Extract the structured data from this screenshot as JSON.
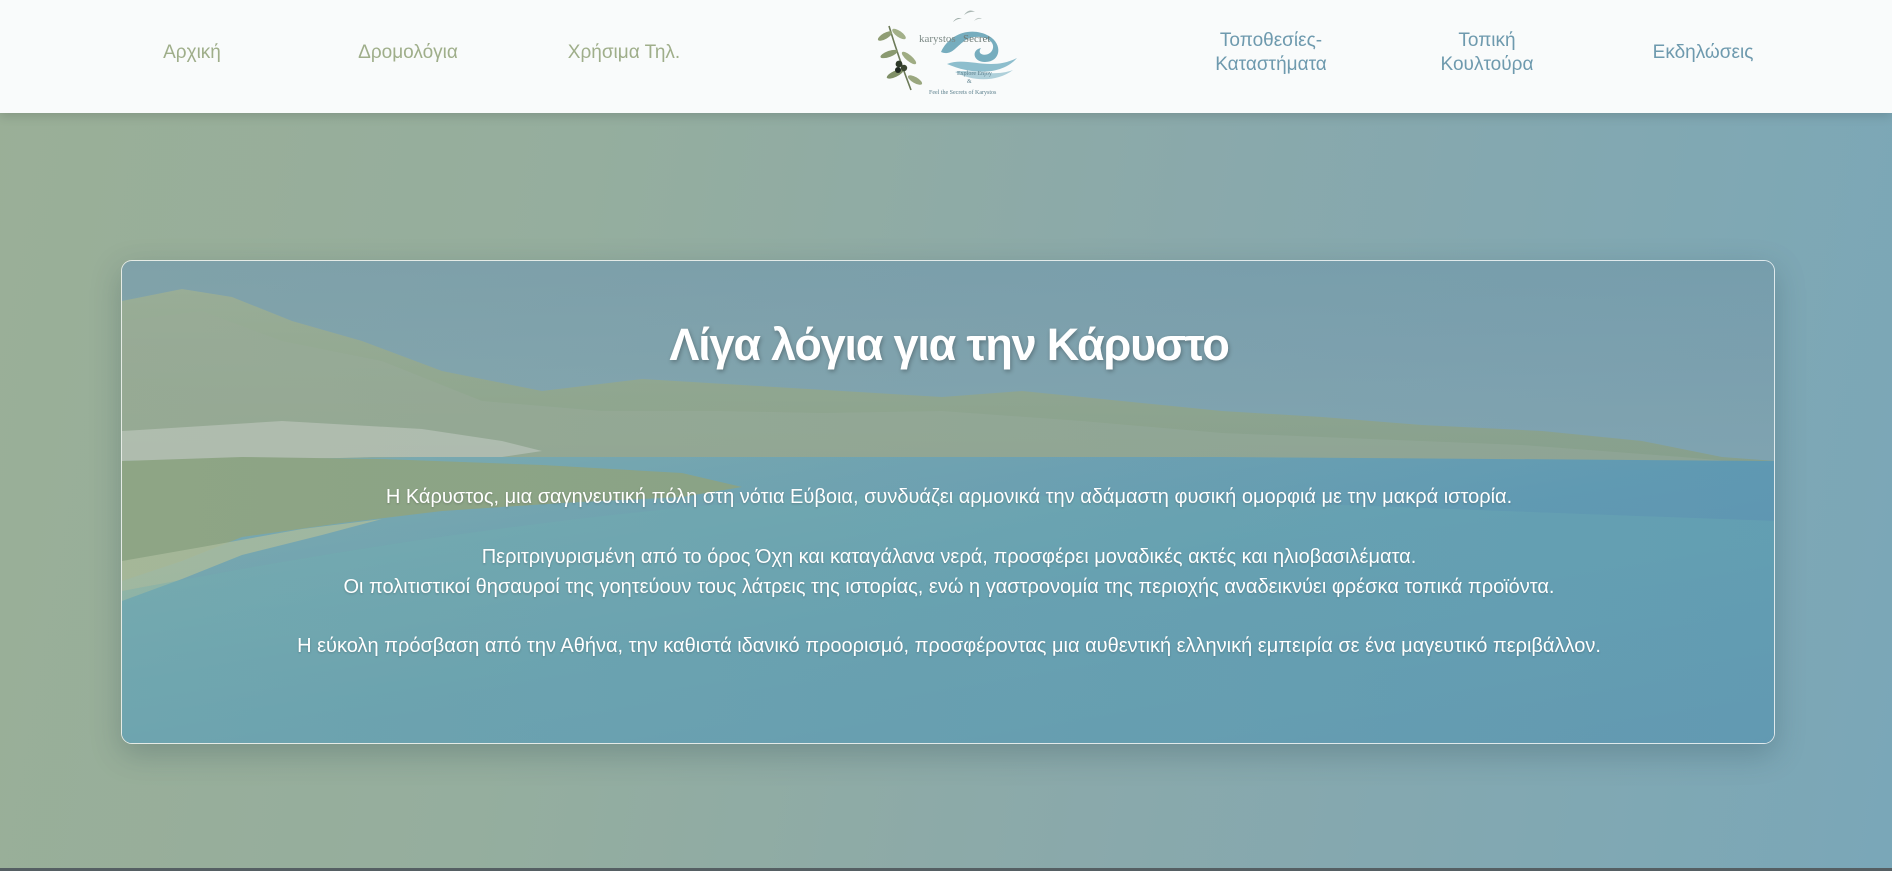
{
  "nav": {
    "left_items": [
      {
        "label": "Αρχική"
      },
      {
        "label": "Δρομολόγια"
      },
      {
        "label": "Χρήσιμα Τηλ."
      }
    ],
    "right_items": [
      {
        "line1": "Τοποθεσίες-",
        "line2": "Καταστήματα"
      },
      {
        "line1": "Τοπική",
        "line2": "Κουλτούρα"
      },
      {
        "line1": "Εκδηλώσεις"
      }
    ],
    "logo": {
      "name_a": "karystos",
      "name_b": "Secret",
      "tagline": "Explore Enjoy",
      "amp": "&",
      "subtitle": "Feel the Secrets of Karystos",
      "icon": "olive-branch-wave-logo"
    }
  },
  "hero": {
    "title": "Λίγα λόγια για την Κάρυστο",
    "paragraph1": "Η Κάρυστος, μια σαγηνευτική πόλη στη νότια Εύβοια, συνδυάζει αρμονικά την αδάμαστη φυσική ομορφιά με την μακρά ιστορία.",
    "paragraph2_line1": "Περιτριγυρισμένη από το όρος Όχη και καταγάλανα νερά, προσφέρει μοναδικές ακτές και ηλιοβασιλέματα.",
    "paragraph2_line2": "Οι πολιτιστικοί θησαυροί της γοητεύουν τους λάτρεις της ιστορίας, ενώ η γαστρονομία της περιοχής αναδεικνύει φρέσκα τοπικά προϊόντα.",
    "paragraph3": "Η εύκολη πρόσβαση από την Αθήνα, την καθιστά ιδανικό προορισμό, προσφέροντας μια αυθεντική ελληνική εμπειρία σε ένα μαγευτικό περιβάλλον."
  },
  "colors": {
    "nav_left_text": "#9fae8a",
    "nav_right_text": "#6e9aae",
    "header_bg": "#f9fbfb",
    "page_gradient_start": "#9aaf97",
    "page_gradient_end": "#7aa7b8"
  }
}
